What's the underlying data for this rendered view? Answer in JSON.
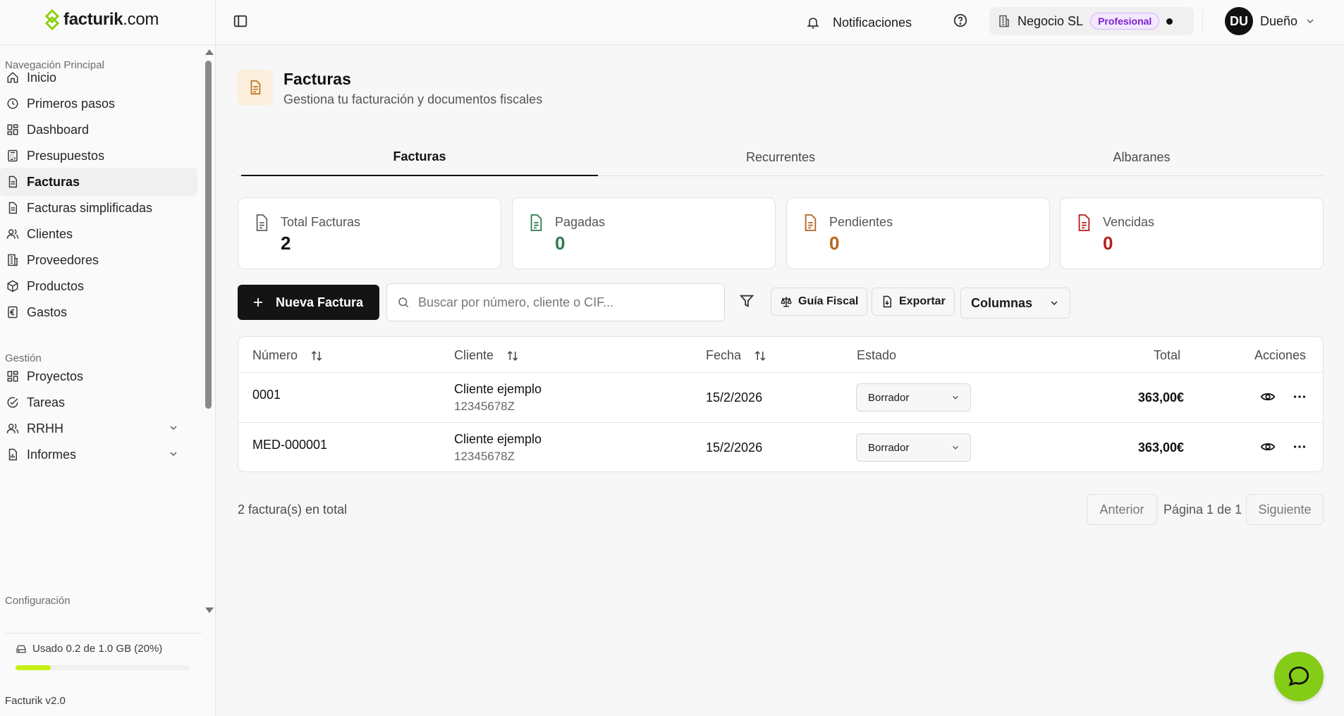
{
  "app": {
    "logo_prefix": "facturik",
    "logo_suffix": ".com",
    "version": "Facturik v2.0"
  },
  "colors": {
    "accent": "#c6f00e",
    "fab": "#84cc16",
    "paid": "#2e7d4f",
    "pending": "#b5651d",
    "overdue": "#b91c1c",
    "badge": "#7e22ce"
  },
  "sidebar": {
    "sections": {
      "main": "Navegación Principal",
      "management": "Gestión",
      "config": "Configuración"
    },
    "items": [
      {
        "label": "Inicio",
        "icon": "home-icon"
      },
      {
        "label": "Primeros pasos",
        "icon": "clock-icon"
      },
      {
        "label": "Dashboard",
        "icon": "grid-icon"
      },
      {
        "label": "Presupuestos",
        "icon": "calculator-icon"
      },
      {
        "label": "Facturas",
        "icon": "document-icon",
        "active": true
      },
      {
        "label": "Facturas simplificadas",
        "icon": "document-icon"
      },
      {
        "label": "Clientes",
        "icon": "users-icon"
      },
      {
        "label": "Proveedores",
        "icon": "building-icon"
      },
      {
        "label": "Productos",
        "icon": "box-icon"
      },
      {
        "label": "Gastos",
        "icon": "euro-receipt-icon"
      }
    ],
    "management_items": [
      {
        "label": "Proyectos",
        "icon": "grid-icon"
      },
      {
        "label": "Tareas",
        "icon": "check-circle-icon"
      },
      {
        "label": "RRHH",
        "icon": "users-icon"
      },
      {
        "label": "Informes",
        "icon": "report-icon"
      }
    ],
    "storage": {
      "label": "Usado 0.2 de 1.0 GB (20%)",
      "fraction": 0.2
    }
  },
  "header": {
    "notifications": "Notificaciones",
    "business": "Negocio SL",
    "plan": "Profesional",
    "user_initials": "DU",
    "user_name": "Dueño"
  },
  "page": {
    "title": "Facturas",
    "subtitle": "Gestiona tu facturación y documentos fiscales",
    "tabs": [
      "Facturas",
      "Recurrentes",
      "Albaranes"
    ],
    "active_tab": "Facturas"
  },
  "stats": [
    {
      "label": "Total Facturas",
      "value": "2",
      "color": "#111111"
    },
    {
      "label": "Pagadas",
      "value": "0",
      "color": "#2e7d4f"
    },
    {
      "label": "Pendientes",
      "value": "0",
      "color": "#b5651d"
    },
    {
      "label": "Vencidas",
      "value": "0",
      "color": "#b91c1c"
    }
  ],
  "toolbar": {
    "new_invoice": "Nueva Factura",
    "search_placeholder": "Buscar por número, cliente o CIF...",
    "fiscal_guide": "Guía Fiscal",
    "export": "Exportar",
    "columns": "Columnas"
  },
  "table": {
    "headers": {
      "number": "Número",
      "client": "Cliente",
      "date": "Fecha",
      "state": "Estado",
      "total": "Total",
      "actions": "Acciones"
    },
    "rows": [
      {
        "number": "0001",
        "client": "Cliente ejemplo",
        "cif": "12345678Z",
        "date": "15/2/2026",
        "state": "Borrador",
        "total": "363,00€"
      },
      {
        "number": "MED-000001",
        "client": "Cliente ejemplo",
        "cif": "12345678Z",
        "date": "15/2/2026",
        "state": "Borrador",
        "total": "363,00€"
      }
    ]
  },
  "pagination": {
    "summary": "2 factura(s) en total",
    "prev": "Anterior",
    "page": "Página 1 de 1",
    "next": "Siguiente"
  }
}
